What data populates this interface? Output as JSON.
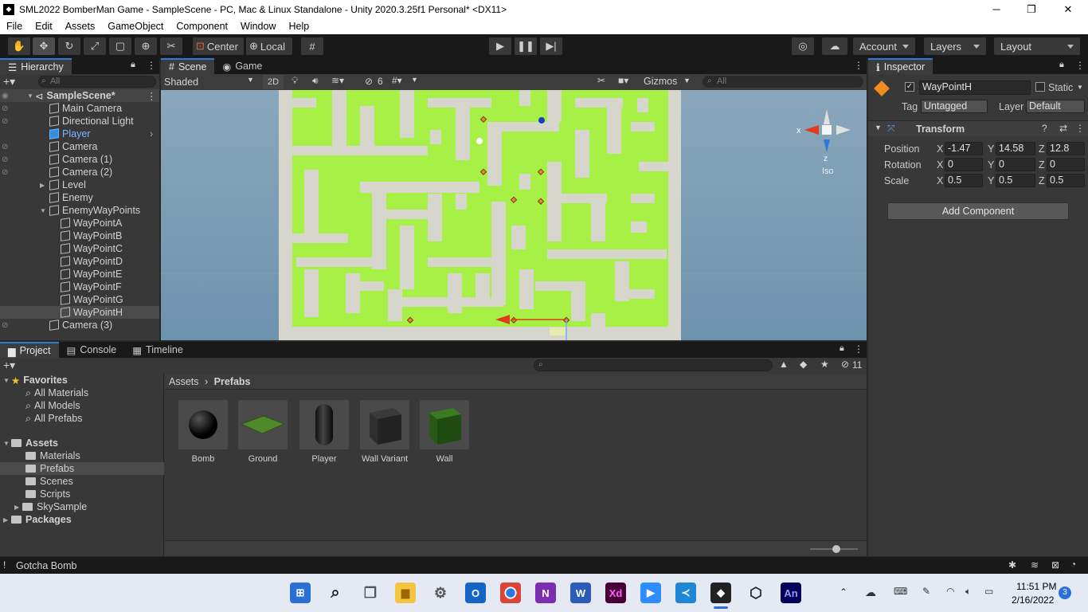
{
  "window": {
    "title": "SML2022 BomberMan Game - SampleScene - PC, Mac & Linux Standalone - Unity 2020.3.25f1 Personal* <DX11>",
    "minimize": "─",
    "restore": "❐",
    "close": "✕"
  },
  "menu": [
    "File",
    "Edit",
    "Assets",
    "GameObject",
    "Component",
    "Window",
    "Help"
  ],
  "toolbar": {
    "pivot_label": "Center",
    "space_label": "Local",
    "account_label": "Account",
    "layers_label": "Layers",
    "layout_label": "Layout"
  },
  "hierarchy": {
    "tab_label": "Hierarchy",
    "search_placeholder": "All",
    "items": [
      {
        "label": "SampleScene*"
      },
      {
        "label": "Main Camera"
      },
      {
        "label": "Directional Light"
      },
      {
        "label": "Player"
      },
      {
        "label": "Camera"
      },
      {
        "label": "Camera (1)"
      },
      {
        "label": "Camera (2)"
      },
      {
        "label": "Level"
      },
      {
        "label": "Enemy"
      },
      {
        "label": "EnemyWayPoints"
      },
      {
        "label": "WayPointA"
      },
      {
        "label": "WayPointB"
      },
      {
        "label": "WayPointC"
      },
      {
        "label": "WayPointD"
      },
      {
        "label": "WayPointE"
      },
      {
        "label": "WayPointF"
      },
      {
        "label": "WayPointG"
      },
      {
        "label": "WayPointH"
      },
      {
        "label": "Camera (3)"
      }
    ]
  },
  "scene": {
    "tab_scene": "Scene",
    "tab_game": "Game",
    "shading_mode": "Shaded",
    "mode_2d": "2D",
    "hidden_count": "6",
    "gizmos_label": "Gizmos",
    "search_placeholder": "All",
    "axis_x": "x",
    "axis_z": "z",
    "projection": "Iso",
    "colors": {
      "sky": "#7a9cb6",
      "floor": "#a7f146",
      "wall": "#d6d6cc"
    }
  },
  "inspector": {
    "tab_label": "Inspector",
    "object_name": "WayPointH",
    "static_label": "Static",
    "tag_label": "Tag",
    "tag_value": "Untagged",
    "layer_label": "Layer",
    "layer_value": "Default",
    "component_title": "Transform",
    "position_label": "Position",
    "rotation_label": "Rotation",
    "scale_label": "Scale",
    "position": {
      "x": "-1.47",
      "y": "14.58",
      "z": "12.8"
    },
    "rotation": {
      "x": "0",
      "y": "0",
      "z": "0"
    },
    "scale": {
      "x": "0.5",
      "y": "0.5",
      "z": "0.5"
    },
    "x_label": "X",
    "y_label": "Y",
    "z_label": "Z",
    "add_component_label": "Add Component"
  },
  "bottom_tabs": {
    "project": "Project",
    "console": "Console",
    "timeline": "Timeline"
  },
  "project": {
    "hidden_count": "11",
    "favorites_label": "Favorites",
    "favorites": [
      "All Materials",
      "All Models",
      "All Prefabs"
    ],
    "assets_label": "Assets",
    "asset_folders": [
      "Materials",
      "Prefabs",
      "Scenes",
      "Scripts",
      "SkySample"
    ],
    "packages_label": "Packages",
    "breadcrumb_root": "Assets",
    "breadcrumb_current": "Prefabs",
    "prefabs": [
      {
        "name": "Bomb",
        "icon": "sphere-black"
      },
      {
        "name": "Ground",
        "icon": "plane-green"
      },
      {
        "name": "Player",
        "icon": "capsule-black"
      },
      {
        "name": "Wall Variant",
        "icon": "cube-dark"
      },
      {
        "name": "Wall",
        "icon": "cube-green"
      }
    ]
  },
  "status": {
    "message": "Gotcha Bomb"
  },
  "taskbar": {
    "time": "11:51 PM",
    "date": "2/16/2022",
    "notification_count": "3",
    "apps": [
      "Xd",
      "An"
    ]
  }
}
